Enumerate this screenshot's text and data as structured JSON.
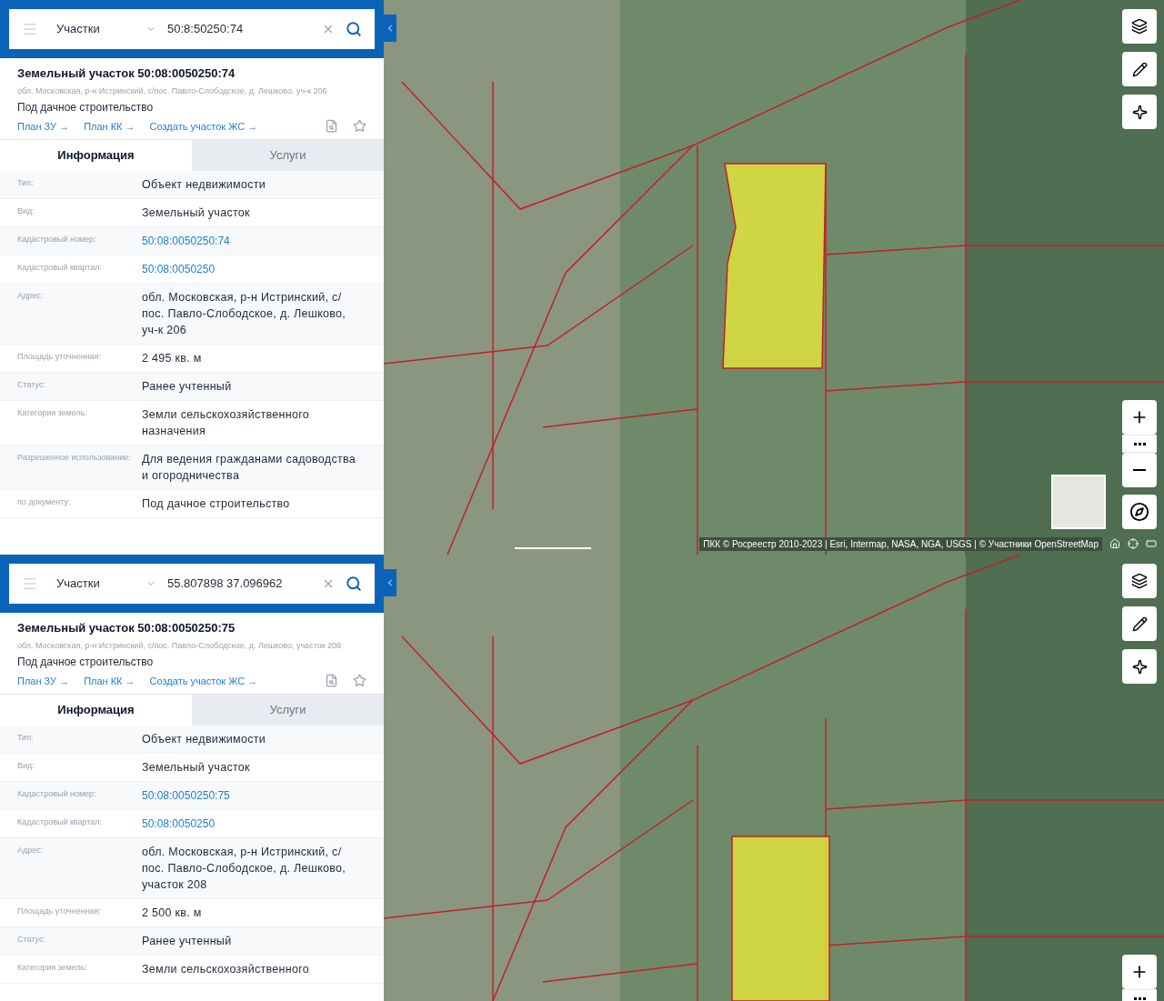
{
  "panels": [
    {
      "search": {
        "category": "Участки",
        "query": "50:8:50250:74"
      },
      "title": "Земельный участок 50:08:0050250:74",
      "address": "обл. Московская, р-н Истринский, с/пос. Павло-Слободское, д. Лешково, уч-к 206",
      "purpose": "Под дачное строительство",
      "links": [
        "План ЗУ →",
        "План КК →",
        "Создать участок ЖС →"
      ],
      "tabs": [
        {
          "label": "Информация",
          "selected": true
        },
        {
          "label": "Услуги",
          "selected": false
        }
      ],
      "rows": [
        {
          "label": "Тип:",
          "value": "Объект недвижимости",
          "kind": "text"
        },
        {
          "label": "Вид:",
          "value": "Земельный участок",
          "kind": "text"
        },
        {
          "label": "Кадастровый номер:",
          "value": "50:08:0050250:74",
          "kind": "link"
        },
        {
          "label": "Кадастровый квартал:",
          "value": "50:08:0050250",
          "kind": "link"
        },
        {
          "label": "Адрес:",
          "value": "обл. Московская, р-н Истринский, с/ пос. Павло-Слободское, д. Лешково, уч-к 206",
          "kind": "text"
        },
        {
          "label": "Площадь уточненная:",
          "value": "2 495 кв. м",
          "kind": "text"
        },
        {
          "label": "Статус:",
          "value": "Ранее учтенный",
          "kind": "text"
        },
        {
          "label": "Категория земель:",
          "value": "Земли сельскохозяйственного назначения",
          "kind": "text"
        },
        {
          "label": "Разрешенное использование:",
          "value": "Для ведения гражданами садоводства и огородничества",
          "kind": "text"
        },
        {
          "label": "по документу:",
          "value": "Под дачное строительство",
          "kind": "text"
        }
      ],
      "attribution": "ПКК © Росреестр 2010-2023 | Esri, Intermap, NASA, NGA, USGS | © Участники OpenStreetMap"
    },
    {
      "search": {
        "category": "Участки",
        "query": "55.807898 37.096962"
      },
      "title": "Земельный участок 50:08:0050250:75",
      "address": "обл. Московская, р-н Истринский, с/пос. Павло-Слободское, д. Лешково, участок 208",
      "purpose": "Под дачное строительство",
      "links": [
        "План ЗУ →",
        "План КК →",
        "Создать участок ЖС →"
      ],
      "tabs": [
        {
          "label": "Информация",
          "selected": true
        },
        {
          "label": "Услуги",
          "selected": false
        }
      ],
      "rows": [
        {
          "label": "Тип:",
          "value": "Объект недвижимости",
          "kind": "text"
        },
        {
          "label": "Вид:",
          "value": "Земельный участок",
          "kind": "text"
        },
        {
          "label": "Кадастровый номер:",
          "value": "50:08:0050250:75",
          "kind": "link"
        },
        {
          "label": "Кадастровый квартал:",
          "value": "50:08:0050250",
          "kind": "link"
        },
        {
          "label": "Адрес:",
          "value": "обл. Московская, р-н Истринский, с/ пос. Павло-Слободское, д. Лешково, участок 208",
          "kind": "text"
        },
        {
          "label": "Площадь уточненная:",
          "value": "2 500 кв. м",
          "kind": "text"
        },
        {
          "label": "Статус:",
          "value": "Ранее учтенный",
          "kind": "text"
        },
        {
          "label": "Категория земель:",
          "value": "Земли сельскохозяйственного",
          "kind": "text"
        }
      ]
    }
  ]
}
